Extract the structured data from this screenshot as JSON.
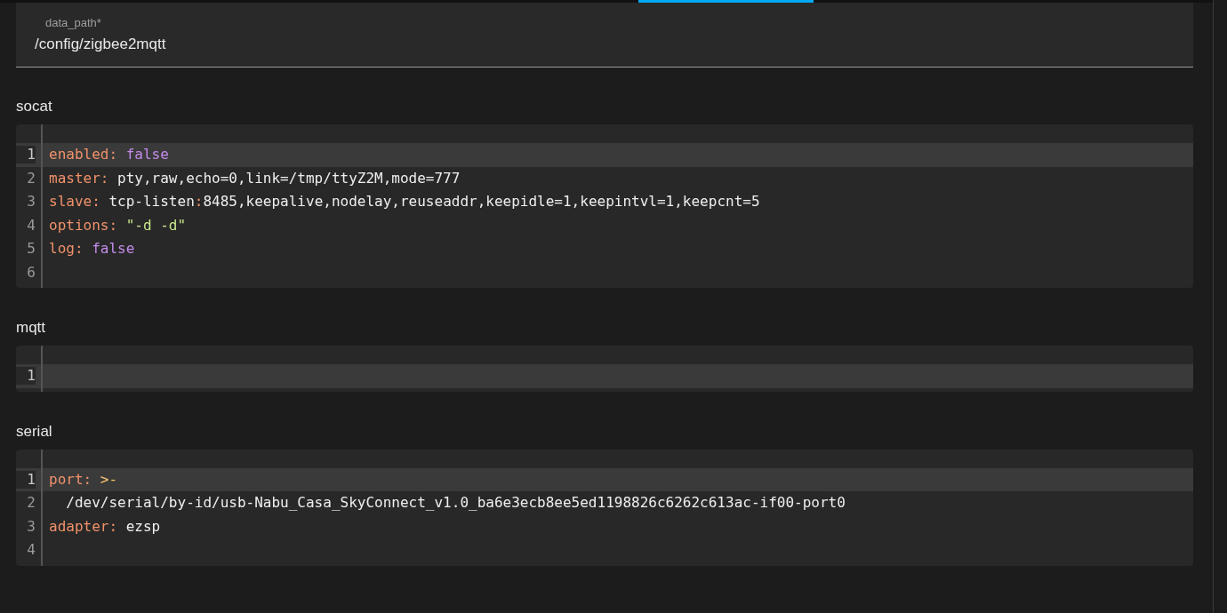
{
  "field": {
    "label": "data_path*",
    "value": "/config/zigbee2mqtt"
  },
  "sections": [
    {
      "title": "socat",
      "lines": [
        {
          "number": "1",
          "active": true,
          "tokens": [
            {
              "kind": "key",
              "text": "enabled"
            },
            {
              "kind": "punct",
              "text": ": "
            },
            {
              "kind": "bool",
              "text": "false"
            }
          ]
        },
        {
          "number": "2",
          "active": false,
          "tokens": [
            {
              "kind": "key",
              "text": "master"
            },
            {
              "kind": "punct",
              "text": ": "
            },
            {
              "kind": "plain",
              "text": "pty,raw,echo=0,link=/tmp/ttyZ2M,mode=777"
            }
          ]
        },
        {
          "number": "3",
          "active": false,
          "tokens": [
            {
              "kind": "key",
              "text": "slave"
            },
            {
              "kind": "punct",
              "text": ": "
            },
            {
              "kind": "plain",
              "text": "tcp-listen"
            },
            {
              "kind": "punct",
              "text": ":"
            },
            {
              "kind": "plain",
              "text": "8485,keepalive,nodelay,reuseaddr,keepidle=1,keepintvl=1,keepcnt=5"
            }
          ]
        },
        {
          "number": "4",
          "active": false,
          "tokens": [
            {
              "kind": "key",
              "text": "options"
            },
            {
              "kind": "punct",
              "text": ": "
            },
            {
              "kind": "string",
              "text": "\"-d -d\""
            }
          ]
        },
        {
          "number": "5",
          "active": false,
          "tokens": [
            {
              "kind": "key",
              "text": "log"
            },
            {
              "kind": "punct",
              "text": ": "
            },
            {
              "kind": "bool",
              "text": "false"
            }
          ]
        },
        {
          "number": "6",
          "active": false
        }
      ]
    },
    {
      "title": "mqtt",
      "lines": [
        {
          "number": "1",
          "active": true
        }
      ]
    },
    {
      "title": "serial",
      "lines": [
        {
          "number": "1",
          "active": true,
          "tokens": [
            {
              "kind": "key",
              "text": "port"
            },
            {
              "kind": "punct",
              "text": ": "
            },
            {
              "kind": "indicator",
              "text": ">-"
            }
          ]
        },
        {
          "number": "2",
          "active": false,
          "tokens": [
            {
              "kind": "plain",
              "text": "  /dev/serial/by-id/usb-Nabu_Casa_SkyConnect_v1.0_ba6e3ecb8ee5ed1198826c6262c613ac-if00-port0"
            }
          ]
        },
        {
          "number": "3",
          "active": false,
          "tokens": [
            {
              "kind": "key",
              "text": "adapter"
            },
            {
              "kind": "punct",
              "text": ": "
            },
            {
              "kind": "plain",
              "text": "ezsp"
            }
          ]
        },
        {
          "number": "4",
          "active": false
        }
      ]
    }
  ]
}
